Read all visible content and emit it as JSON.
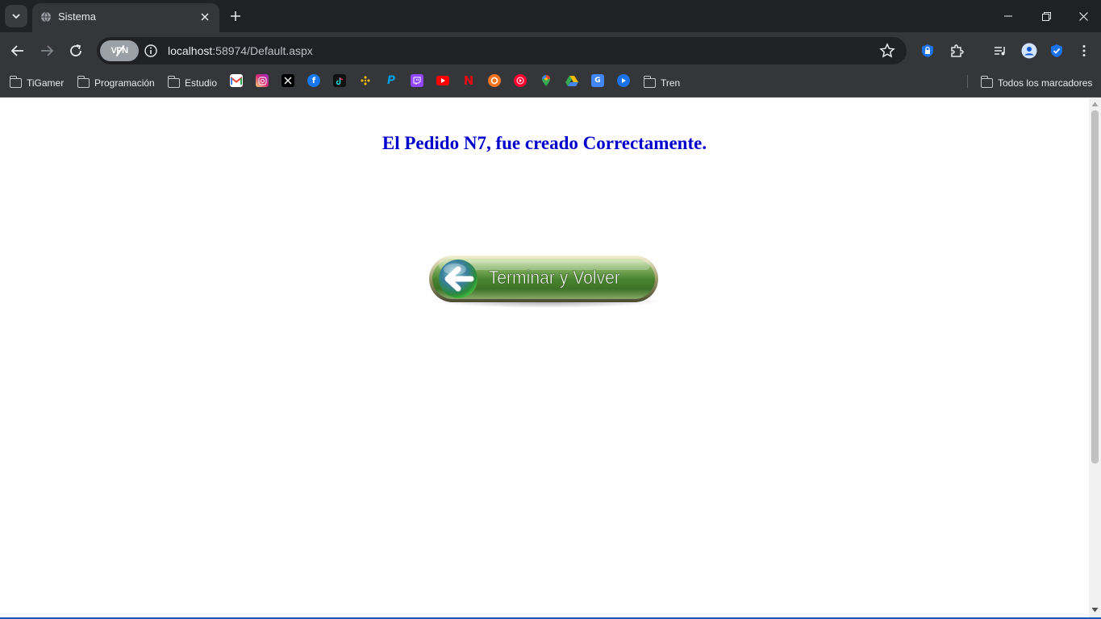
{
  "browser": {
    "tab_title": "Sistema",
    "url_host": "localhost",
    "url_rest": ":58974/Default.aspx",
    "vpn_label": "VPN",
    "bookmarks": {
      "folders": [
        "TiGamer",
        "Programación",
        "Estudio"
      ],
      "trailing_folder": "Tren",
      "all_bookmarks": "Todos los marcadores",
      "site_icons": [
        "gmail-icon",
        "instagram-icon",
        "x-icon",
        "facebook-icon",
        "tiktok-icon",
        "binance-icon",
        "paypal-icon",
        "twitch-icon",
        "youtube-icon",
        "netflix-icon",
        "crunchyroll-icon",
        "youtube-music-icon",
        "google-maps-icon",
        "google-drive-icon",
        "google-translate-icon",
        "play-icon"
      ]
    },
    "colors": {
      "frame": "#202124",
      "toolbar": "#35363a",
      "accent": "#1a73e8"
    }
  },
  "page": {
    "message": "El Pedido N7, fue creado Correctamente.",
    "message_color": "#0000cc",
    "button_label": "Terminar y Volver",
    "button_color": "#4f8f36"
  }
}
